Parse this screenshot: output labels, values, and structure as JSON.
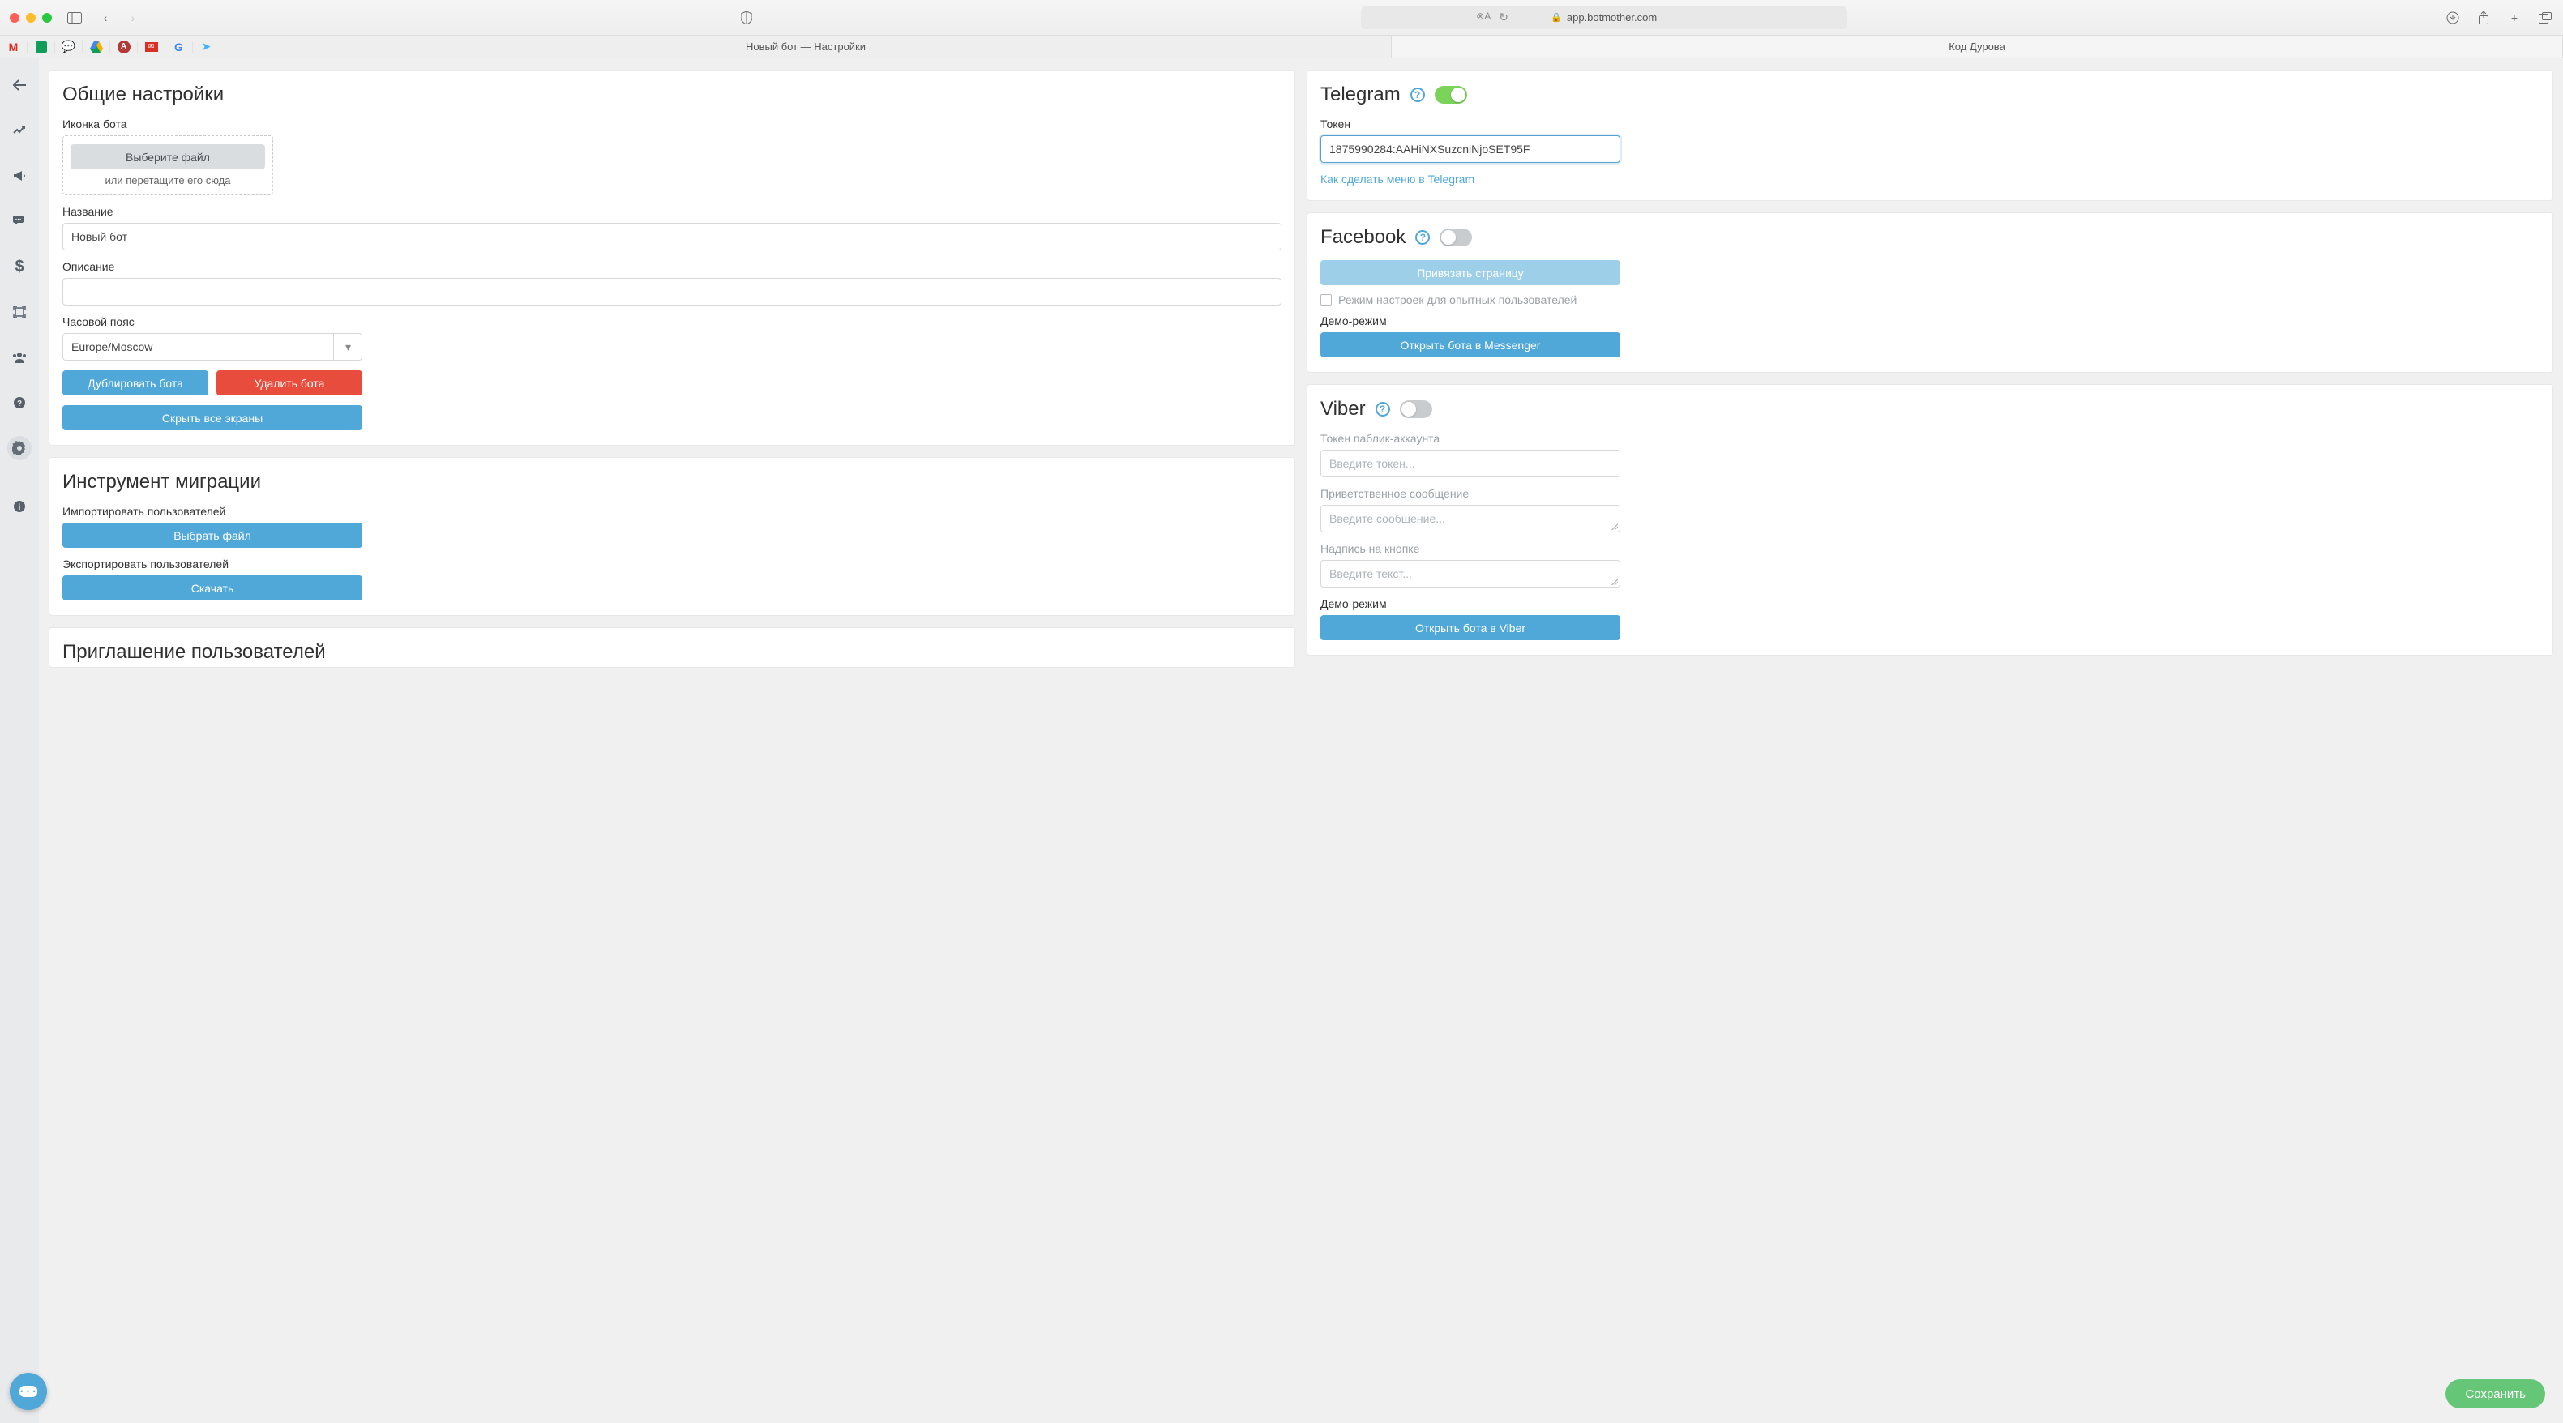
{
  "browser": {
    "url": "app.botmother.com",
    "tabs": [
      {
        "label": "Новый бот — Настройки",
        "active": true
      },
      {
        "label": "Код Дурова",
        "active": false
      }
    ]
  },
  "bookmarks": [
    {
      "name": "gmail",
      "glyph": "M",
      "color": "#d93025"
    },
    {
      "name": "sheets",
      "glyph": "▦",
      "color": "#0f9d58"
    },
    {
      "name": "chat",
      "glyph": "❝",
      "color": "#7e57c2"
    },
    {
      "name": "drive",
      "glyph": "▲",
      "color": "#f4b400"
    },
    {
      "name": "app1",
      "glyph": "A",
      "color": "#fff"
    },
    {
      "name": "mail",
      "glyph": "✉",
      "color": "#fff"
    },
    {
      "name": "google",
      "glyph": "G",
      "color": "#4285f4"
    },
    {
      "name": "next",
      "glyph": "➤",
      "color": "#3db2ff"
    }
  ],
  "sidebar": [
    {
      "icon": "←",
      "name": "back"
    },
    {
      "icon": "chart",
      "name": "analytics"
    },
    {
      "icon": "📣",
      "name": "broadcast"
    },
    {
      "icon": "💬",
      "name": "dialogs"
    },
    {
      "icon": "$",
      "name": "billing"
    },
    {
      "icon": "▣",
      "name": "screens"
    },
    {
      "icon": "👥",
      "name": "users"
    },
    {
      "icon": "?",
      "name": "help"
    },
    {
      "icon": "⚙",
      "name": "settings",
      "active": true
    },
    {
      "icon": "ⓘ",
      "name": "info"
    }
  ],
  "general": {
    "heading": "Общие настройки",
    "icon_label": "Иконка бота",
    "choose_file": "Выберите файл",
    "or_drag": "или перетащите его сюда",
    "name_label": "Название",
    "name_value": "Новый бот",
    "desc_label": "Описание",
    "desc_value": "",
    "tz_label": "Часовой пояс",
    "tz_value": "Europe/Moscow",
    "duplicate": "Дублировать бота",
    "delete": "Удалить бота",
    "hide_all": "Скрыть все экраны"
  },
  "migration": {
    "heading": "Инструмент миграции",
    "import_label": "Импортировать пользователей",
    "import_btn": "Выбрать файл",
    "export_label": "Экспортировать пользователей",
    "export_btn": "Скачать"
  },
  "invite": {
    "heading": "Приглашение пользователей"
  },
  "telegram": {
    "heading": "Telegram",
    "enabled": true,
    "token_label": "Токен",
    "token_value": "1875990284:AAHiNXSuzcniNjoSET95F",
    "menu_link": "Как сделать меню в Telegram"
  },
  "facebook": {
    "heading": "Facebook",
    "enabled": false,
    "bind_page": "Привязать страницу",
    "advanced_label": "Режим настроек для опытных пользователей",
    "demo_label": "Демо-режим",
    "open_btn": "Открыть бота в Messenger"
  },
  "viber": {
    "heading": "Viber",
    "enabled": false,
    "token_label": "Токен паблик-аккаунта",
    "token_placeholder": "Введите токен...",
    "welcome_label": "Приветственное сообщение",
    "welcome_placeholder": "Введите сообщение...",
    "button_label": "Надпись на кнопке",
    "button_placeholder": "Введите текст...",
    "demo_label": "Демо-режим",
    "open_btn": "Открыть бота в Viber"
  },
  "save_btn": "Сохранить"
}
